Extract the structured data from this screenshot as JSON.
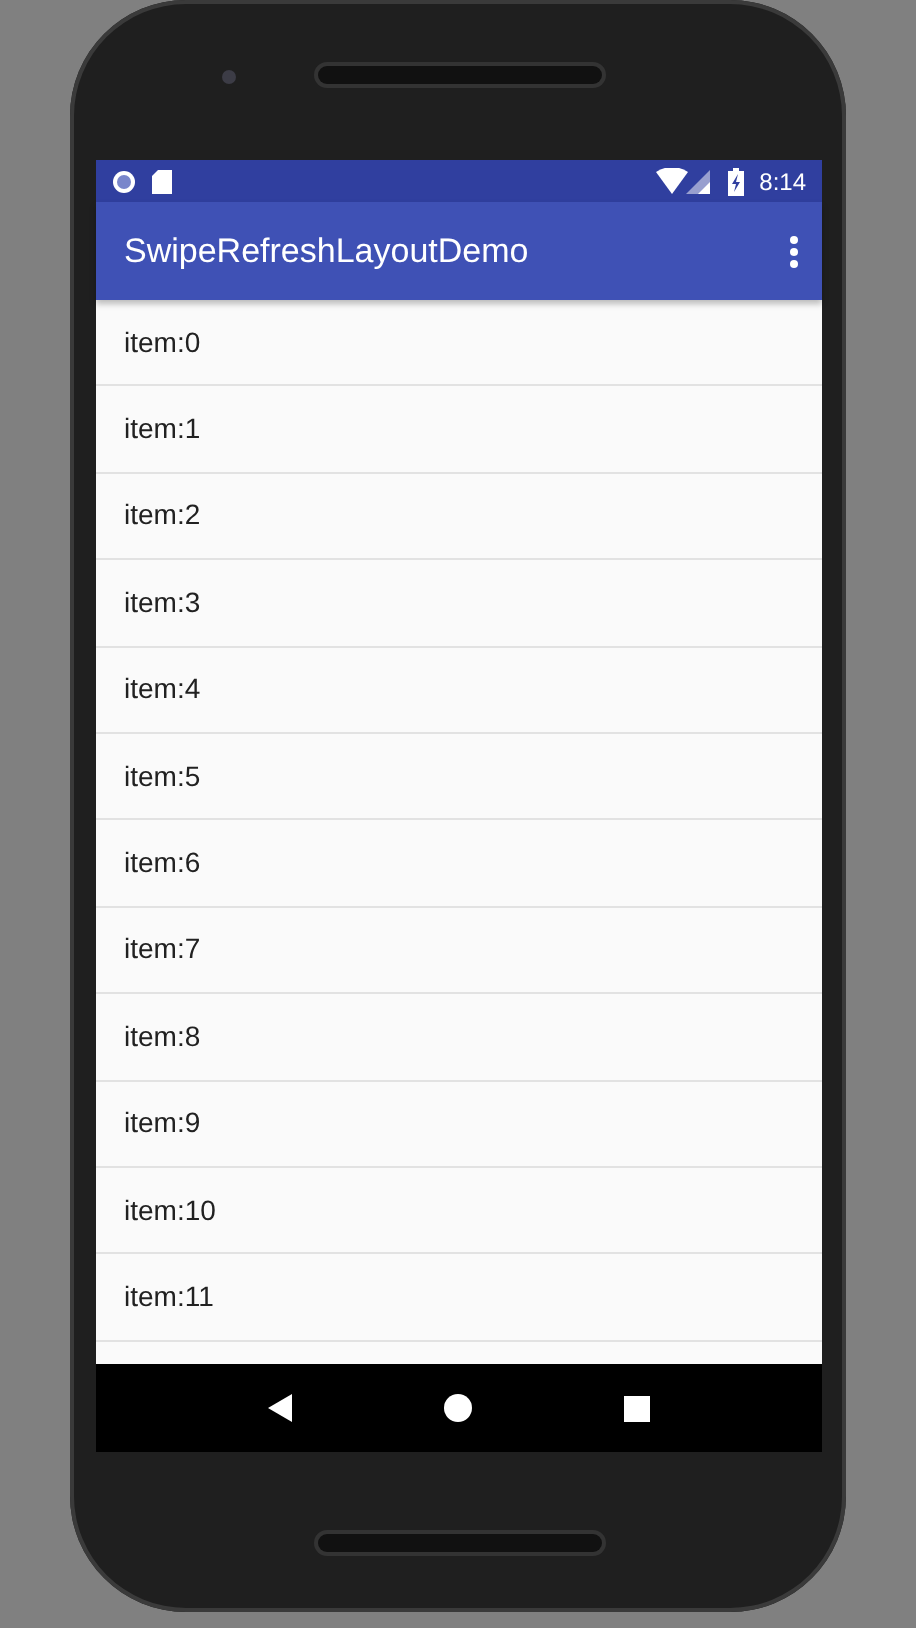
{
  "status_bar": {
    "time": "8:14"
  },
  "app_bar": {
    "title": "SwipeRefreshLayoutDemo"
  },
  "list": [
    {
      "label": "item:0"
    },
    {
      "label": "item:1"
    },
    {
      "label": "item:2"
    },
    {
      "label": "item:3"
    },
    {
      "label": "item:4"
    },
    {
      "label": "item:5"
    },
    {
      "label": "item:6"
    },
    {
      "label": "item:7"
    },
    {
      "label": "item:8"
    },
    {
      "label": "item:9"
    },
    {
      "label": "item:10"
    },
    {
      "label": "item:11"
    }
  ]
}
